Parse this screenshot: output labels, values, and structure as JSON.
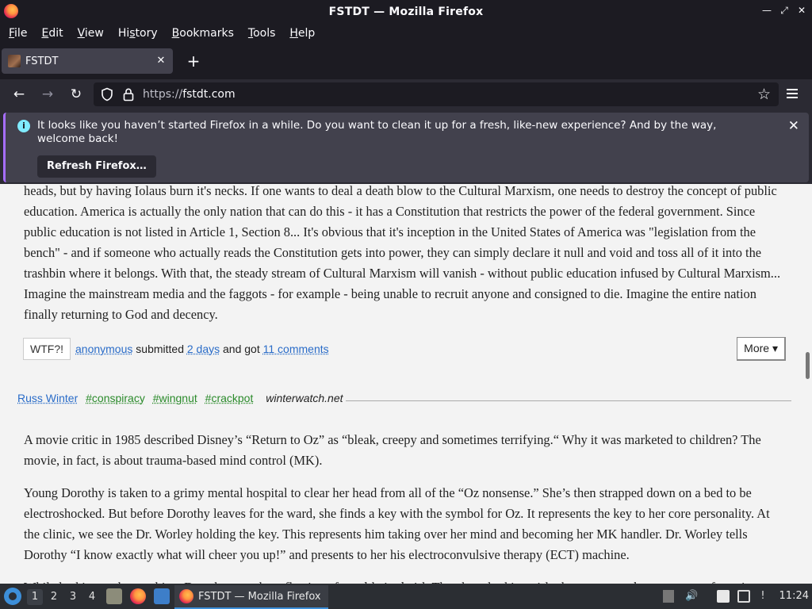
{
  "window": {
    "title": "FSTDT — Mozilla Firefox"
  },
  "menu": {
    "items": [
      {
        "label": "File",
        "access": "F"
      },
      {
        "label": "Edit",
        "access": "E"
      },
      {
        "label": "View",
        "access": "V"
      },
      {
        "label": "History",
        "access": "s"
      },
      {
        "label": "Bookmarks",
        "access": "B"
      },
      {
        "label": "Tools",
        "access": "T"
      },
      {
        "label": "Help",
        "access": "H"
      }
    ]
  },
  "tabs": [
    {
      "title": "FSTDT",
      "active": true
    }
  ],
  "urlbar": {
    "scheme": "https://",
    "host": "fstdt.com"
  },
  "notification": {
    "message": "It looks like you haven’t started Firefox in a while. Do you want to clean it up for a fresh, like-new experience? And by the way, welcome back!",
    "button_label": "Refresh Firefox…"
  },
  "post1": {
    "text": "heads, but by having Iolaus burn it's necks. If one wants to deal a death blow to the Cultural Marxism, one needs to destroy the concept of public education. America is actually the only nation that can do this - it has a Constitution that restricts the power of the federal government. Since public education is not listed in Article 1, Section 8... It's obvious that it's inception in the United States of America was \"legislation from the bench\" - and if someone who actually reads the Constitution gets into power, they can simply declare it null and void and toss all of it into the trashbin where it belongs. With that, the steady stream of Cultural Marxism will vanish - without public education infused by Cultural Marxism... Imagine the mainstream media and the faggots - for example - being unable to recruit anyone and consigned to die. Imagine the entire nation finally returning to God and decency.",
    "wtf_label": "WTF?!",
    "author": "anonymous",
    "submitted_text": "submitted",
    "time": "2 days",
    "got_text": "and got",
    "comments": "11 comments",
    "more_label": "More ▾"
  },
  "post2": {
    "author": "Russ Winter",
    "tags": [
      "#conspiracy",
      "#wingnut",
      "#crackpot"
    ],
    "source": "winterwatch.net",
    "paragraphs": [
      "A movie critic in 1985 described Disney’s “Return to Oz” as “bleak, creepy and sometimes terrifying.“ Why it was marketed to children? The movie, in fact, is about trauma-based mind control (MK).",
      "Young Dorothy is taken to a grimy mental hospital to clear her head from all of the “Oz nonsense.” She’s then strapped down on a bed to be electroshocked. But before Dorothy leaves for the ward, she finds a key with the symbol for Oz. It represents the key to her core personality. At the clinic, we see the Dr. Worley holding the key. This represents him taking over her mind and becoming her MK handler. Dr. Worley tells Dorothy “I know exactly what will cheer you up!” and presents to her his electroconvulsive therapy (ECT) machine.",
      "While looking at the machine, Dorothy sees the reflection of a red-haired girl. The ghost-looking girl who appears to be a remnant of previous..."
    ]
  },
  "taskbar": {
    "workspaces": [
      "1",
      "2",
      "3",
      "4"
    ],
    "active_workspace": "1",
    "task_label": "FSTDT — Mozilla Firefox",
    "clock": "11:24"
  }
}
